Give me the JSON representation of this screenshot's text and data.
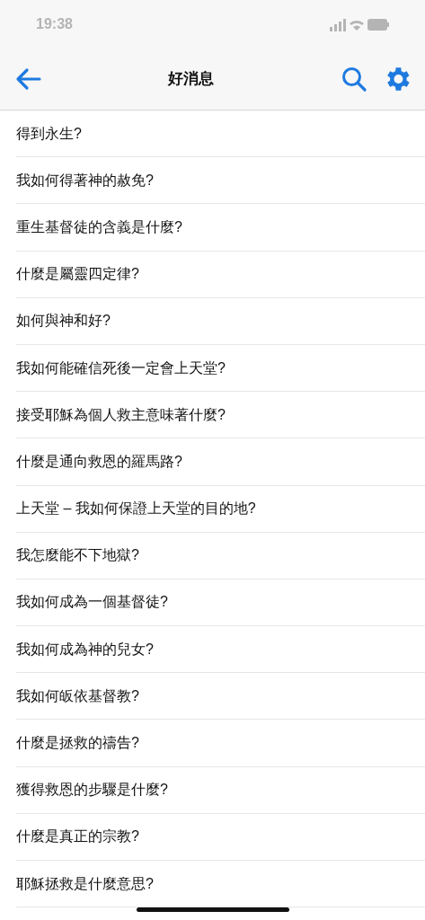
{
  "status_bar": {
    "time": "19:38"
  },
  "nav_bar": {
    "title": "好消息"
  },
  "items": [
    {
      "title": "得到永生?"
    },
    {
      "title": "我如何得著神的赦免?"
    },
    {
      "title": "重生基督徒的含義是什麼?"
    },
    {
      "title": "什麼是屬靈四定律?"
    },
    {
      "title": "如何與神和好?"
    },
    {
      "title": "我如何能確信死後一定會上天堂?"
    },
    {
      "title": "接受耶穌為個人救主意味著什麼?"
    },
    {
      "title": "什麼是通向救恩的羅馬路?"
    },
    {
      "title": "上天堂 – 我如何保證上天堂的目的地?"
    },
    {
      "title": "我怎麼能不下地獄?"
    },
    {
      "title": "我如何成為一個基督徒?"
    },
    {
      "title": "我如何成為神的兒女?"
    },
    {
      "title": "我如何皈依基督教?"
    },
    {
      "title": "什麼是拯救的禱告?"
    },
    {
      "title": "獲得救恩的步驟是什麼?"
    },
    {
      "title": "什麼是真正的宗教?"
    },
    {
      "title": "耶穌拯救是什麼意思?"
    }
  ]
}
